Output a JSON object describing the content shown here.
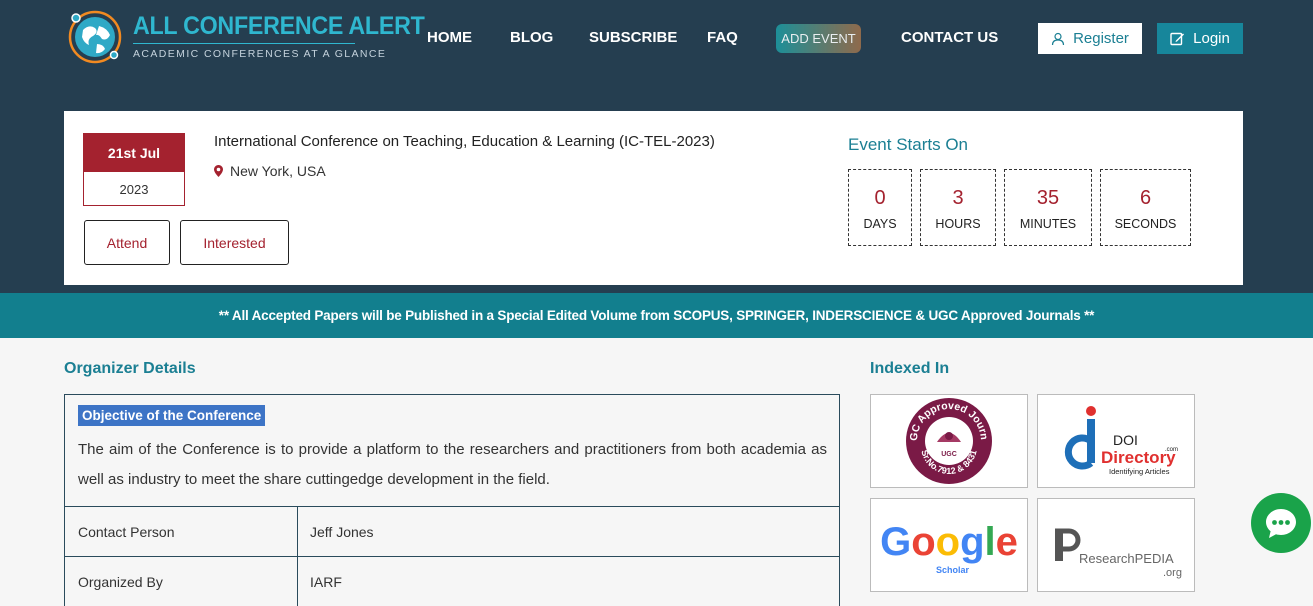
{
  "brand": {
    "title": "ALL CONFERENCE ALERT",
    "tagline": "ACADEMIC CONFERENCES AT A GLANCE",
    "logo_icon": "globe-icon",
    "accent_color": "#2fb7cf"
  },
  "nav": {
    "items": [
      "HOME",
      "BLOG",
      "SUBSCRIBE",
      "FAQ",
      "ADD EVENT",
      "CONTACT US"
    ],
    "register_label": "Register",
    "login_label": "Login",
    "register_icon": "user-icon",
    "login_icon": "edit-icon"
  },
  "event": {
    "date_day": "21st Jul",
    "date_year": "2023",
    "title": "International Conference on Teaching, Education & Learning (IC-TEL-2023)",
    "location": "New York, USA",
    "location_icon": "map-marker-icon",
    "attend_label": "Attend",
    "interested_label": "Interested",
    "starts_label": "Event Starts On",
    "countdown": [
      {
        "value": "0",
        "label": "DAYS"
      },
      {
        "value": "3",
        "label": "HOURS"
      },
      {
        "value": "35",
        "label": "MINUTES"
      },
      {
        "value": "6",
        "label": "SECONDS"
      }
    ],
    "brand_red": "#a4222f"
  },
  "banner": {
    "text": "** All Accepted Papers will be Published in a Special Edited Volume from SCOPUS, SPRINGER, INDERSCIENCE & UGC Approved Journals **",
    "color": "#127f8e"
  },
  "organizer": {
    "section_title": "Organizer Details",
    "objective_label": "Objective of the Conference",
    "objective_text": "The aim of the Conference is to provide a platform to the researchers and practitioners from both academia as well as industry to meet the share cuttingedge development in the field.",
    "rows": [
      {
        "label": "Contact Person",
        "value": "Jeff Jones"
      },
      {
        "label": "Organized By",
        "value": "IARF"
      }
    ]
  },
  "indexed": {
    "section_title": "Indexed In",
    "ugc_ring_text": "UGC Approved Journal",
    "ugc_center": "UGC",
    "ugc_number": "Sr.No.7912 & 8431",
    "doi_top": "DOI",
    "doi_main": "Directory",
    "doi_com": ".com",
    "doi_sub": "Identifying Articles",
    "google_text": "Google",
    "google_sub": "Scholar",
    "rp_text": "ResearchPEDIA",
    "rp_org": ".org"
  },
  "chat": {
    "icon": "chat-bubble-icon"
  }
}
